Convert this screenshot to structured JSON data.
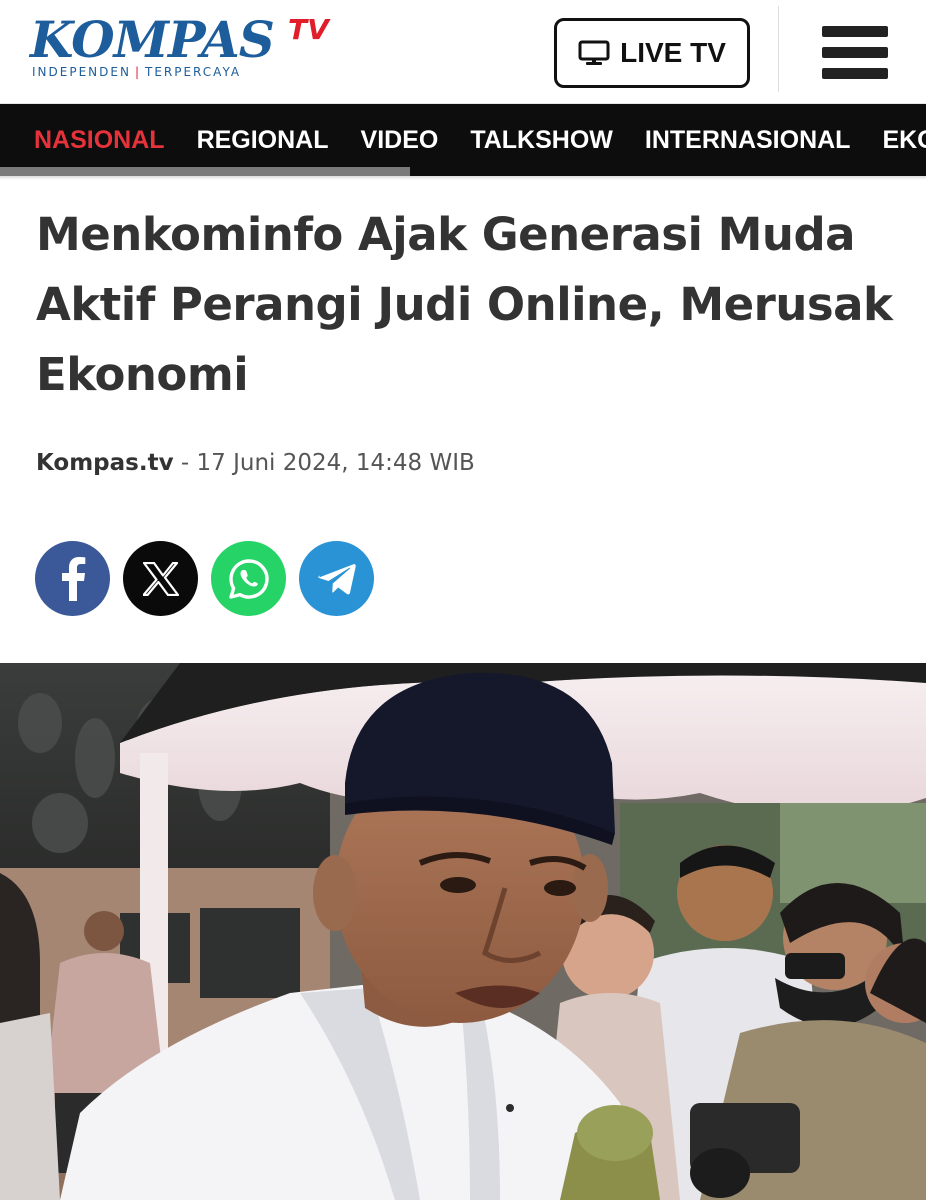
{
  "header": {
    "logo": {
      "name": "KOMPAS",
      "suffix": "TV",
      "tagline_left": "INDEPENDEN",
      "tagline_sep": "|",
      "tagline_right": "TERPERCAYA"
    },
    "live_button": {
      "label": "LIVE TV",
      "icon": "tv-icon"
    },
    "menu_icon": "hamburger-menu-icon"
  },
  "nav": {
    "items": [
      {
        "label": "NASIONAL",
        "active": true
      },
      {
        "label": "REGIONAL",
        "active": false
      },
      {
        "label": "VIDEO",
        "active": false
      },
      {
        "label": "TALKSHOW",
        "active": false
      },
      {
        "label": "INTERNASIONAL",
        "active": false
      },
      {
        "label": "EKONOMI",
        "active": false
      }
    ],
    "active_color": "#e5323b"
  },
  "article": {
    "title": "Menkominfo Ajak Generasi Muda Aktif Perangi Judi Online, Merusak Ekonomi",
    "source": "Kompas.tv",
    "separator": " - ",
    "date": "17 Juni 2024, 14:48 WIB"
  },
  "share": [
    {
      "name": "facebook",
      "icon": "facebook-icon",
      "color": "#3b5998"
    },
    {
      "name": "x",
      "icon": "x-icon",
      "color": "#0a0a0a"
    },
    {
      "name": "whatsapp",
      "icon": "whatsapp-icon",
      "color": "#25d366"
    },
    {
      "name": "telegram",
      "icon": "telegram-icon",
      "color": "#2a93d5"
    }
  ],
  "colors": {
    "brand_blue": "#1d5d9b",
    "brand_red": "#e11d2a",
    "nav_bg": "#0d0d0d"
  }
}
